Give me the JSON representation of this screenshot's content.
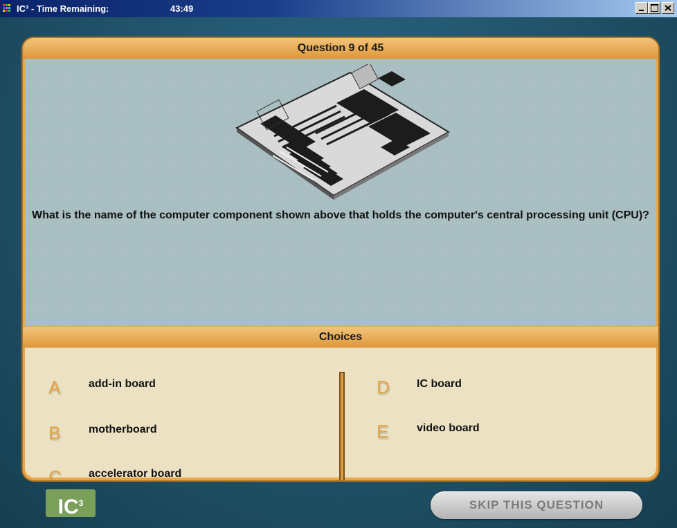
{
  "window": {
    "title": "IC³ - Time Remaining:",
    "time_remaining": "43:49",
    "controls": [
      "minimize",
      "maximize",
      "close"
    ]
  },
  "question": {
    "header": "Question 9 of 45",
    "image": "motherboard-illustration",
    "text": "What is the name of the computer component shown above that holds the computer's central processing unit (CPU)?"
  },
  "choices": {
    "header": "Choices",
    "left": [
      {
        "letter": "A",
        "label": "add-in board"
      },
      {
        "letter": "B",
        "label": "motherboard"
      },
      {
        "letter": "C",
        "label": "accelerator board"
      }
    ],
    "right": [
      {
        "letter": "D",
        "label": "IC board"
      },
      {
        "letter": "E",
        "label": "video board"
      }
    ]
  },
  "footer": {
    "logo_text": "IC",
    "logo_sup": "3",
    "skip_label": "SKIP THIS QUESTION"
  },
  "colors": {
    "accent": "#e9a74a",
    "question_bg": "#a6bcc0",
    "choices_bg": "#ece2c3",
    "background": "#1f4f65"
  }
}
